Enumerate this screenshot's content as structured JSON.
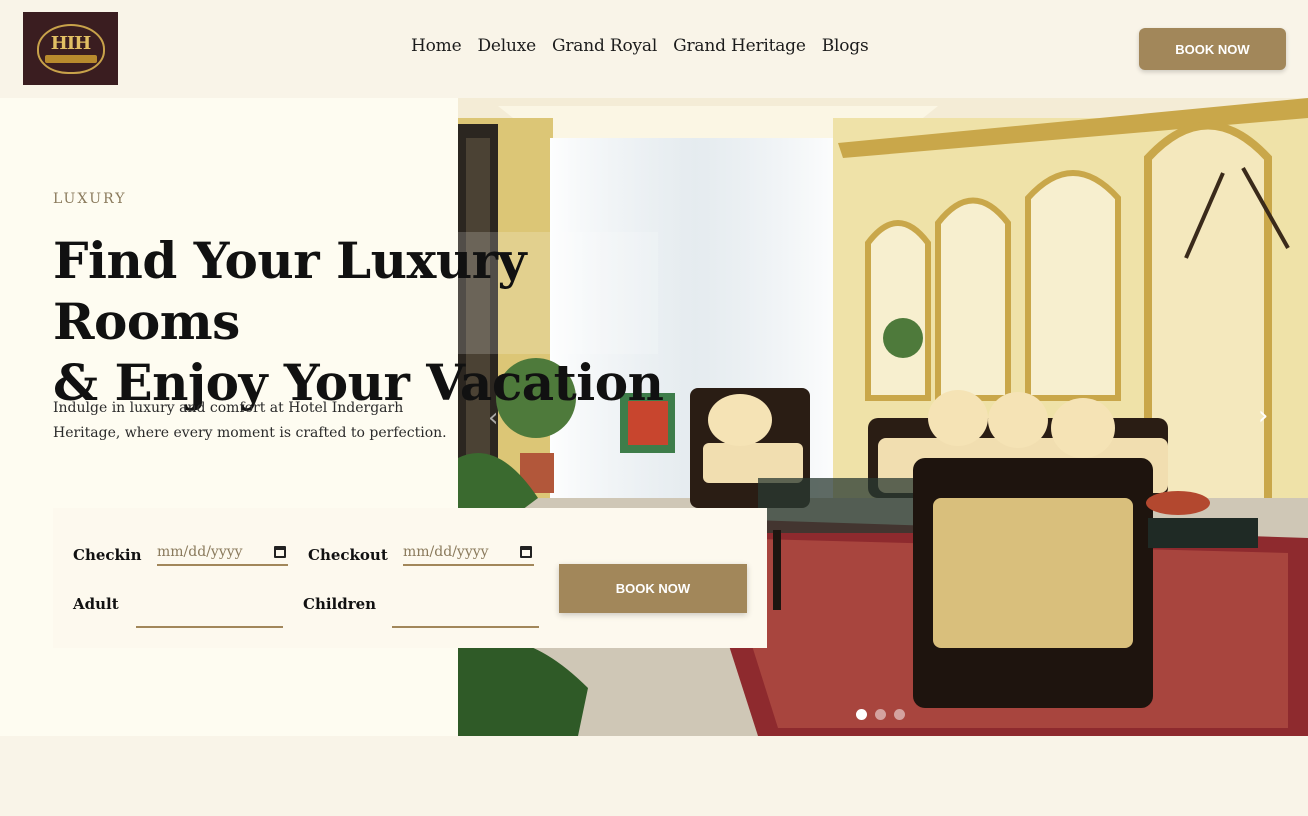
{
  "header": {
    "logo_text": "HIH",
    "nav": [
      "Home",
      "Deluxe",
      "Grand Royal",
      "Grand Heritage",
      "Blogs"
    ],
    "book_button": "BOOK NOW"
  },
  "hero": {
    "eyebrow": "LUXURY",
    "title_line1": "Find Your Luxury Rooms",
    "title_line2": "& Enjoy Your Vacation",
    "description": "Indulge in luxury and comfort at Hotel Indergarh Heritage, where every moment is crafted to perfection."
  },
  "booking": {
    "checkin_label": "Checkin",
    "checkin_placeholder": "mm/dd/yyyy",
    "checkout_label": "Checkout",
    "checkout_placeholder": "mm/dd/yyyy",
    "adult_label": "Adult",
    "children_label": "Children",
    "button": "BOOK NOW"
  },
  "slider": {
    "prev_icon": "chevron-left-icon",
    "next_icon": "chevron-right-icon",
    "dot_count": 3,
    "active_dot": 0
  },
  "colors": {
    "accent": "#a2875a",
    "page_bg": "#f9f4e8",
    "panel_bg": "#fefcf1",
    "logo_bg": "#3a1d20"
  }
}
